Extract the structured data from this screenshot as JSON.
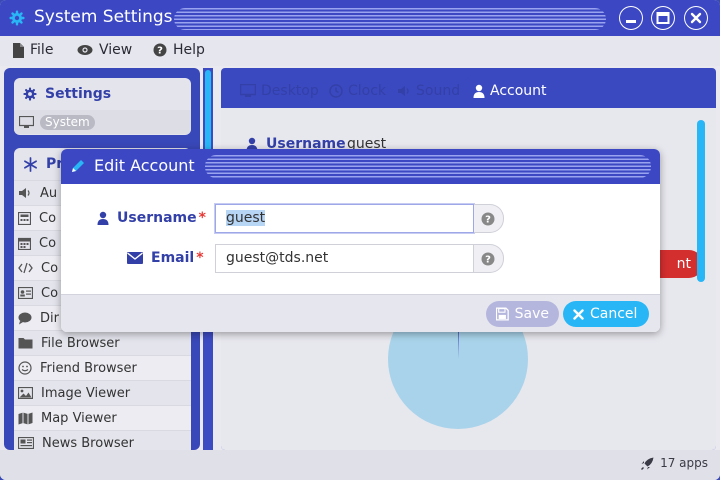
{
  "window": {
    "title": "System Settings"
  },
  "menu": [
    {
      "label": "File",
      "icon": "file-icon"
    },
    {
      "label": "View",
      "icon": "eye-icon"
    },
    {
      "label": "Help",
      "icon": "question-circle-icon"
    }
  ],
  "sidebar": {
    "settings": {
      "title": "Settings",
      "item": "System"
    },
    "programs": {
      "title": "Pr",
      "items": [
        {
          "label": "Au",
          "icon": "volume-icon"
        },
        {
          "label": "Co",
          "icon": "calculator-icon"
        },
        {
          "label": "Co",
          "icon": "calendar-icon"
        },
        {
          "label": "Co",
          "icon": "code-icon"
        },
        {
          "label": "Co",
          "icon": "contact-card-icon"
        },
        {
          "label": "Dir",
          "icon": "chat-bubble-icon"
        },
        {
          "label": "File Browser",
          "icon": "folder-icon"
        },
        {
          "label": "Friend Browser",
          "icon": "smiley-icon"
        },
        {
          "label": "Image Viewer",
          "icon": "image-icon"
        },
        {
          "label": "Map Viewer",
          "icon": "map-icon"
        },
        {
          "label": "News Browser",
          "icon": "newspaper-icon"
        }
      ]
    }
  },
  "tabs": [
    {
      "label": "Desktop",
      "icon": "monitor-icon"
    },
    {
      "label": "Clock",
      "icon": "clock-icon"
    },
    {
      "label": "Sound",
      "icon": "speaker-icon"
    },
    {
      "label": "Account",
      "icon": "user-icon",
      "active": true
    }
  ],
  "account": {
    "username_label": "Username",
    "username_value": "guest",
    "button_fragment": "nt"
  },
  "status": {
    "apps": "17 apps"
  },
  "dialog": {
    "title": "Edit Account",
    "fields": [
      {
        "label": "Username",
        "value": "guest",
        "required": "*",
        "icon": "user-icon"
      },
      {
        "label": "Email",
        "value": "guest@tds.net",
        "required": "*",
        "icon": "envelope-icon"
      }
    ],
    "save_label": "Save",
    "cancel_label": "Cancel"
  },
  "colors": {
    "primary": "#3c48c3",
    "accent": "#29b6f6",
    "danger": "#e53935",
    "pie": "#a9d3ea"
  }
}
